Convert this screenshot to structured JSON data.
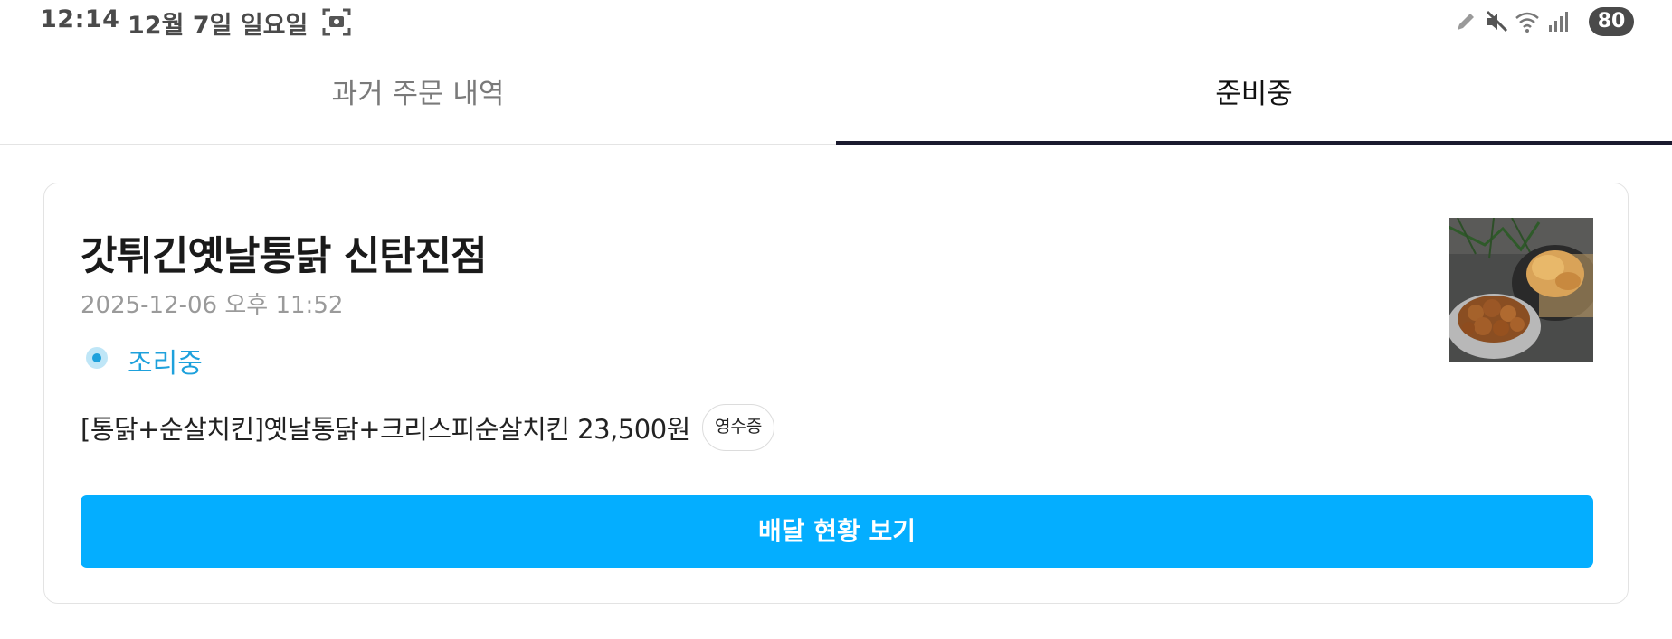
{
  "status_bar": {
    "time": "12:14",
    "date": "12월 7일 일요일",
    "battery": "80",
    "icons": [
      "screenshot-icon",
      "pencil-icon",
      "mute-icon",
      "wifi-icon",
      "signal-icon"
    ]
  },
  "tabs": [
    {
      "label": "과거 주문 내역",
      "active": false
    },
    {
      "label": "준비중",
      "active": true
    }
  ],
  "order": {
    "store_name": "갓튀긴옛날통닭 신탄진점",
    "datetime": "2025-12-06 오후 11:52",
    "status": "조리중",
    "menu": "[통닭+순살치킨]옛날통닭+크리스피순살치킨 23,500원",
    "receipt_label": "영수증",
    "cta_label": "배달 현황 보기"
  },
  "colors": {
    "accent": "#04aeff",
    "status": "#1ea1dc",
    "tab_underline": "#1a1a2e"
  }
}
